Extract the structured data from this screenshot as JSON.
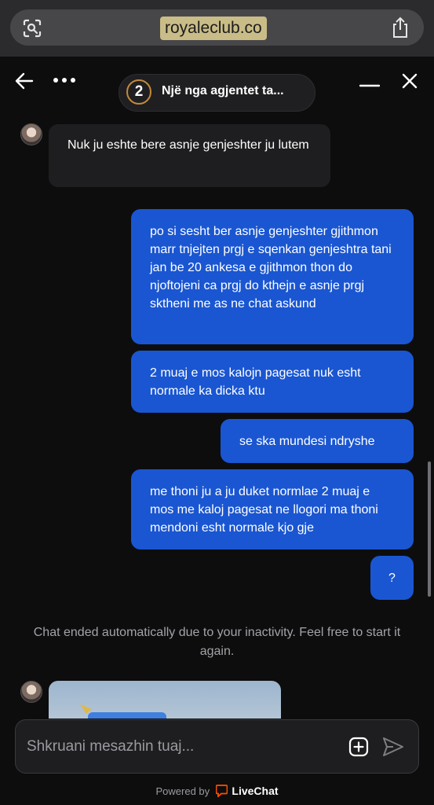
{
  "browser": {
    "url": "royaleclub.co"
  },
  "header": {
    "agent_count": "2",
    "agent_title": "Një nga agjentet ta..."
  },
  "messages": [
    {
      "from": "agent",
      "text": "Nuk ju eshte bere asnje genjeshter ju lutem"
    },
    {
      "from": "user",
      "text": "po si sesht ber asnje genjeshter gjithmon marr tnjejten prgj e sqenkan genjeshtra tani jan be 20 ankesa e gjithmon thon do njoftojeni ca prgj do kthejn e asnje prgj sktheni me as ne chat askund"
    },
    {
      "from": "user",
      "text": "2 muaj e mos kalojn pagesat nuk esht normale ka dicka ktu"
    },
    {
      "from": "user",
      "text": "se ska mundesi ndryshe"
    },
    {
      "from": "user",
      "text": "me thoni ju a ju duket normlae 2 muaj e mos me kaloj pagesat ne llogori ma thoni mendoni esht normale kjo gje"
    },
    {
      "from": "user",
      "text": "?"
    }
  ],
  "system_message": "Chat ended automatically due to your inactivity. Feel free to start it again.",
  "composer": {
    "placeholder": "Shkruani mesazhin tuaj..."
  },
  "footer": {
    "powered_by": "Powered by",
    "brand": "LiveChat"
  },
  "colors": {
    "user_bubble": "#1a56d1",
    "agent_bubble": "#1e1e20",
    "background": "#0d0d0e",
    "brand": "#ff5100"
  },
  "icons": [
    "screenshot-lens-icon",
    "share-icon",
    "back-arrow-icon",
    "more-icon",
    "minimize-icon",
    "close-icon",
    "attach-plus-icon",
    "send-icon",
    "livechat-logo-icon"
  ]
}
